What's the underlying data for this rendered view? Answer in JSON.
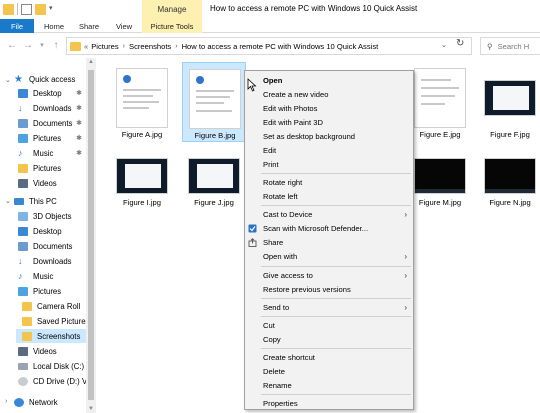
{
  "window": {
    "title": "How to access a remote PC with Windows 10 Quick Assist",
    "context_tab_group": "Manage"
  },
  "ribbon": {
    "tabs": [
      "File",
      "Home",
      "Share",
      "View",
      "Picture Tools"
    ]
  },
  "address": {
    "crumbs": [
      "Pictures",
      "Screenshots",
      "How to access a remote PC with Windows 10 Quick Assist"
    ],
    "overflow": "«",
    "search_placeholder": "Search H"
  },
  "nav": {
    "items": [
      {
        "label": "Quick access"
      },
      {
        "label": "Desktop"
      },
      {
        "label": "Downloads"
      },
      {
        "label": "Documents"
      },
      {
        "label": "Pictures"
      },
      {
        "label": "Music"
      },
      {
        "label": "Pictures"
      },
      {
        "label": "Videos"
      },
      {
        "label": "This PC"
      },
      {
        "label": "3D Objects"
      },
      {
        "label": "Desktop"
      },
      {
        "label": "Documents"
      },
      {
        "label": "Downloads"
      },
      {
        "label": "Music"
      },
      {
        "label": "Pictures"
      },
      {
        "label": "Camera Roll"
      },
      {
        "label": "Saved Pictures"
      },
      {
        "label": "Screenshots"
      },
      {
        "label": "Videos"
      },
      {
        "label": "Local Disk (C:)"
      },
      {
        "label": "CD Drive (D:) Vir"
      },
      {
        "label": "Network"
      }
    ]
  },
  "files": [
    {
      "name": "Figure A.jpg"
    },
    {
      "name": "Figure B.jpg"
    },
    {
      "name": "Figure E.jpg"
    },
    {
      "name": "Figure F.jpg"
    },
    {
      "name": "Figure I.jpg"
    },
    {
      "name": "Figure J.jpg"
    },
    {
      "name": "Figure M.jpg"
    },
    {
      "name": "Figure N.jpg"
    }
  ],
  "context_menu": {
    "items": [
      "Open",
      "Create a new video",
      "Edit with Photos",
      "Edit with Paint 3D",
      "Set as desktop background",
      "Edit",
      "Print",
      "Rotate right",
      "Rotate left",
      "Cast to Device",
      "Scan with Microsoft Defender...",
      "Share",
      "Open with",
      "Give access to",
      "Restore previous versions",
      "Send to",
      "Cut",
      "Copy",
      "Create shortcut",
      "Delete",
      "Rename",
      "Properties"
    ]
  },
  "colors": {
    "accent": "#1979ca",
    "selection": "#cce8ff",
    "context_tab": "#fdf0b0"
  }
}
